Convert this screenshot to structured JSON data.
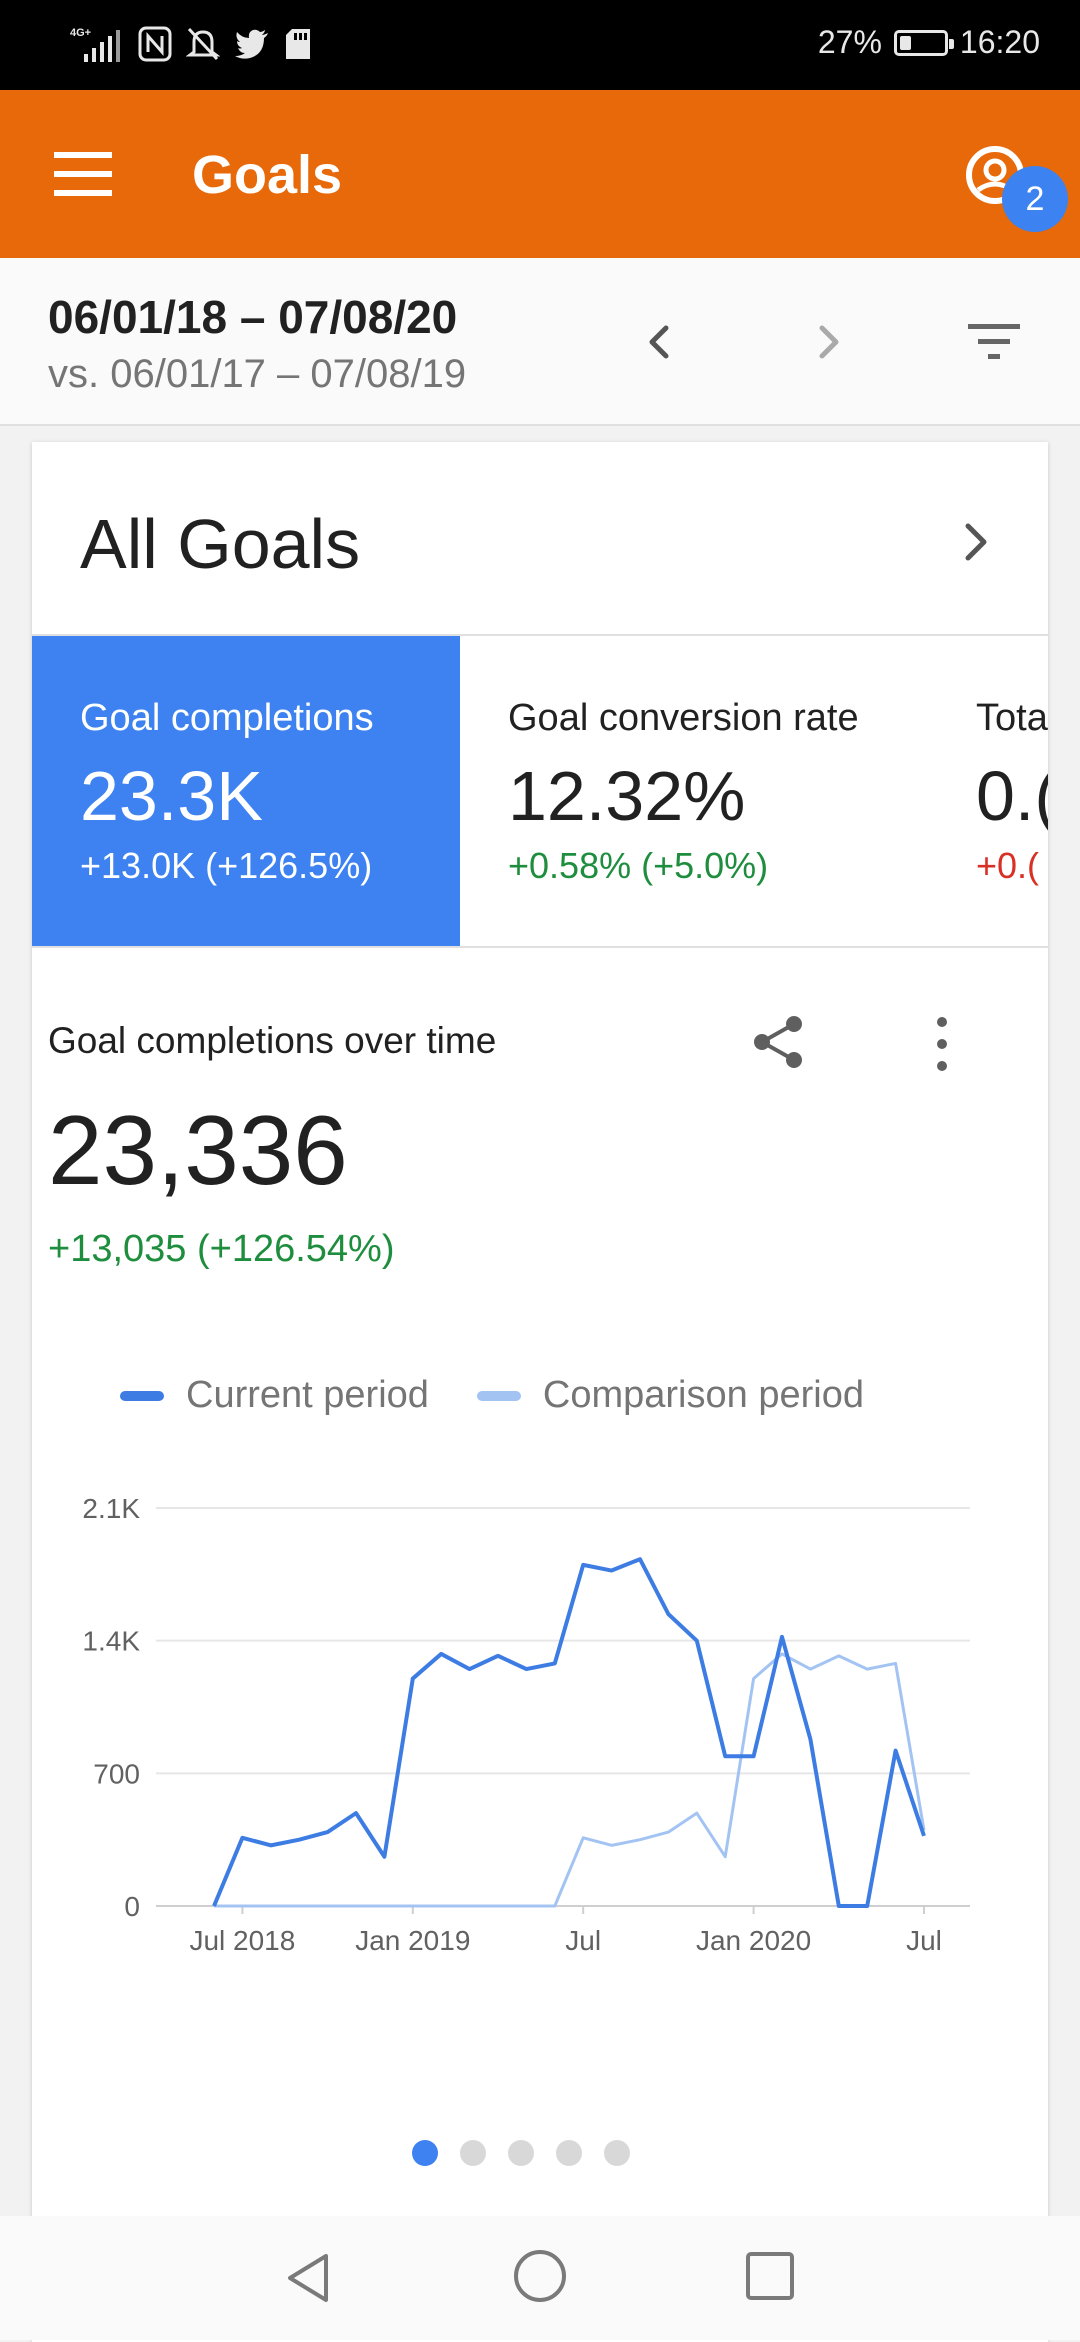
{
  "status_bar": {
    "battery_text": "27%",
    "battery_level": 0.27,
    "time": "16:20",
    "icons": [
      "network-4g-icon",
      "signal-icon",
      "nfc-icon",
      "mute-icon",
      "twitter-icon",
      "sd-card-icon"
    ]
  },
  "app_bar": {
    "title": "Goals",
    "account_badge": "2",
    "color": "#e8690a"
  },
  "date_bar": {
    "range": "06/01/18 – 07/08/20",
    "comparison": "vs. 06/01/17 – 07/08/19"
  },
  "card": {
    "title": "All Goals",
    "metrics": [
      {
        "label": "Goal completions",
        "value": "23.3K",
        "change": "+13.0K (+126.5%)",
        "active": true
      },
      {
        "label": "Goal conversion rate",
        "value": "12.32%",
        "change": "+0.58% (+5.0%)",
        "trend": "up"
      },
      {
        "label": "Tota",
        "value": "0.(",
        "change": "+0.(",
        "trend": "down"
      }
    ],
    "chart_section": {
      "title": "Goal completions over time",
      "total": "23,336",
      "change": "+13,035 (+126.54%)"
    },
    "page_count": 5,
    "active_page": 0
  },
  "colors": {
    "accent": "#3d82f0",
    "current_series": "#3d7de3",
    "comparison_series": "#a3c4f3",
    "positive": "#1e8e3e",
    "negative": "#d93025"
  },
  "chart_data": {
    "type": "line",
    "x_tick_labels": [
      "Jul 2018",
      "Jan 2019",
      "Jul",
      "Jan 2020",
      "Jul"
    ],
    "y_tick_labels": [
      "0",
      "700",
      "1.4K",
      "2.1K"
    ],
    "ylim": [
      0,
      2100
    ],
    "grid": true,
    "legend_placement": "top",
    "series": [
      {
        "name": "Current period",
        "values": [
          0,
          360,
          320,
          350,
          390,
          490,
          260,
          1200,
          1330,
          1250,
          1320,
          1250,
          1280,
          1800,
          1770,
          1830,
          1540,
          1400,
          790,
          790,
          1420,
          880,
          0,
          0,
          820,
          370
        ]
      },
      {
        "name": "Comparison period",
        "values": [
          0,
          0,
          0,
          0,
          0,
          0,
          0,
          0,
          0,
          0,
          0,
          0,
          0,
          360,
          320,
          350,
          390,
          490,
          260,
          1200,
          1330,
          1250,
          1320,
          1250,
          1280,
          400
        ]
      }
    ]
  }
}
